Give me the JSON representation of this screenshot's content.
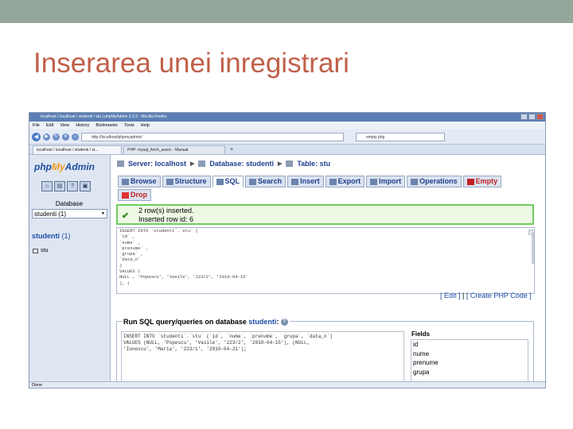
{
  "slide": {
    "title": "Inserarea unei inregistrari"
  },
  "browser": {
    "window_title": "localhost / localhost / studenti / stu | phpMyAdmin 3.2.3 - Mozilla Firefox",
    "menu": [
      "File",
      "Edit",
      "View",
      "History",
      "Bookmarks",
      "Tools",
      "Help"
    ],
    "url": "http://localhost/phpmyadmin/",
    "search_value": "empty php",
    "tabs": [
      {
        "label": "localhost / localhost / studenti / st..."
      },
      {
        "label": "PHP: mysql_fetch_assoc - Manual"
      }
    ],
    "status": "Done"
  },
  "pma": {
    "logo_php": "php",
    "logo_my": "My",
    "logo_admin": "Admin",
    "database_label": "Database",
    "database_selected": "studenti (1)",
    "db_link_name": "studenti",
    "db_link_count": "(1)",
    "table_name": "stu",
    "breadcrumb": {
      "server": "Server: localhost",
      "database": "Database: studenti",
      "table": "Table: stu"
    },
    "tabs": [
      "Browse",
      "Structure",
      "SQL",
      "Search",
      "Insert",
      "Export",
      "Import",
      "Operations",
      "Empty"
    ],
    "tab_drop": "Drop",
    "success_line1": "2 row(s) inserted.",
    "success_line2": "Inserted row id: 6",
    "sql_lines": [
      "INSERT INTO `studenti`.`stu` (",
      "`id` ,",
      "`nume` ,",
      "`prenume` ,",
      "`grupa` ,",
      "`data_n`",
      ")",
      "VALUES (",
      "NULL , 'Popescu', 'Vasile', '223/2', '2010-04-15'",
      "), ("
    ],
    "edit_link": "[ Edit ]",
    "create_php_link": "[ Create PHP Code ]",
    "run_title_prefix": "Run SQL query/queries on database",
    "run_title_db": "studenti",
    "run_sql": "INSERT INTO `studenti`.`stu` (`id`, `nume`, `prenume`, `grupa`, `data_n`)\nVALUES (NULL, 'Popescu', 'Vasile', '223/2', '2010-04-15'), (NULL,\n'Ionescu', 'Maria', '223/1', '2010-04-21');",
    "fields_label": "Fields",
    "fields": [
      "id",
      "nume",
      "prenume",
      "grupa"
    ]
  }
}
